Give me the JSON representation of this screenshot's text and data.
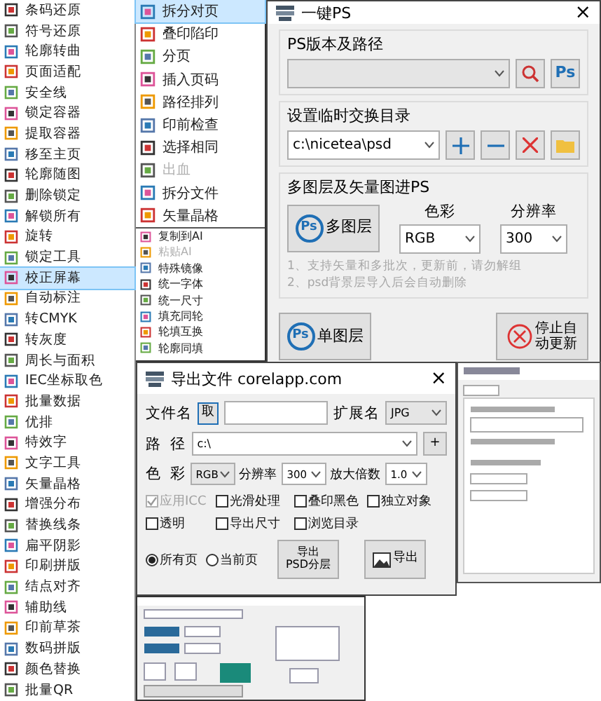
{
  "left_menu": [
    {
      "label": "条码还原",
      "selected": false
    },
    {
      "label": "符号还原",
      "selected": false
    },
    {
      "label": "轮廓转曲",
      "selected": false
    },
    {
      "label": "页面适配",
      "selected": false
    },
    {
      "label": "安全线",
      "selected": false
    },
    {
      "label": "锁定容器",
      "selected": false
    },
    {
      "label": "提取容器",
      "selected": false
    },
    {
      "label": "移至主页",
      "selected": false
    },
    {
      "label": "轮廓随图",
      "selected": false
    },
    {
      "label": "删除锁定",
      "selected": false
    },
    {
      "label": "解锁所有",
      "selected": false
    },
    {
      "label": "旋转",
      "selected": false
    },
    {
      "label": "锁定工具",
      "selected": false
    },
    {
      "label": "校正屏幕",
      "selected": true
    },
    {
      "label": "自动标注",
      "selected": false
    },
    {
      "label": "转CMYK",
      "selected": false
    },
    {
      "label": "转灰度",
      "selected": false
    },
    {
      "label": "周长与面积",
      "selected": false
    },
    {
      "label": "IEC坐标取色",
      "selected": false
    },
    {
      "label": "批量数据",
      "selected": false
    },
    {
      "label": "优排",
      "selected": false
    },
    {
      "label": "特效字",
      "selected": false
    },
    {
      "label": "文字工具",
      "selected": false
    },
    {
      "label": "矢量晶格",
      "selected": false
    },
    {
      "label": "增强分布",
      "selected": false
    },
    {
      "label": "替换线条",
      "selected": false
    },
    {
      "label": "扁平阴影",
      "selected": false
    },
    {
      "label": "印刷拼版",
      "selected": false
    },
    {
      "label": "结点对齐",
      "selected": false
    },
    {
      "label": "辅助线",
      "selected": false
    },
    {
      "label": "印前草茶",
      "selected": false
    },
    {
      "label": "数码拼版",
      "selected": false
    },
    {
      "label": "颜色替换",
      "selected": false
    },
    {
      "label": "批量QR",
      "selected": false
    }
  ],
  "sub_menu": [
    {
      "label": "拆分对页",
      "selected": true,
      "disabled": false
    },
    {
      "label": "叠印陷印",
      "selected": false,
      "disabled": false
    },
    {
      "label": "分页",
      "selected": false,
      "disabled": false
    },
    {
      "label": "插入页码",
      "selected": false,
      "disabled": false
    },
    {
      "label": "路径排列",
      "selected": false,
      "disabled": false
    },
    {
      "label": "印前检查",
      "selected": false,
      "disabled": false
    },
    {
      "label": "选择相同",
      "selected": false,
      "disabled": false
    },
    {
      "label": "出血",
      "selected": false,
      "disabled": true
    },
    {
      "label": "拆分文件",
      "selected": false,
      "disabled": false
    },
    {
      "label": "矢量晶格",
      "selected": false,
      "disabled": false
    }
  ],
  "sub_menu_small": [
    {
      "label": "复制到AI",
      "disabled": false
    },
    {
      "label": "粘贴AI",
      "disabled": true
    },
    {
      "label": "特殊镜像",
      "disabled": false
    },
    {
      "label": "统一字体",
      "disabled": false
    },
    {
      "label": "统一尺寸",
      "disabled": false
    },
    {
      "label": "填充同轮",
      "disabled": false
    },
    {
      "label": "轮填互换",
      "disabled": false
    },
    {
      "label": "轮廓同填",
      "disabled": false
    }
  ],
  "ps_dialog": {
    "title": "一键PS",
    "close": "×",
    "version_group": {
      "title": "PS版本及路径",
      "ps_button": "Ps"
    },
    "temp_group": {
      "title": "设置临时交换目录",
      "path": "c:\\nicetea\\psd"
    },
    "layers_group": {
      "title": "多图层及矢量图进PS",
      "multi_button": "多图层",
      "ps_badge": "Ps",
      "color_label": "色彩",
      "color_value": "RGB",
      "res_label": "分辨率",
      "res_value": "300",
      "notes": [
        "1、支持矢量和多批次，更新前，请勿解组",
        "2、psd背景层导入后会自动删除"
      ]
    },
    "single_button": "单图层",
    "single_badge": "Ps",
    "stop_button": "停止自动更新"
  },
  "export_dialog": {
    "title": "导出文件  corelapp.com",
    "close": "×",
    "name_label": "文件名",
    "take_button": "取",
    "ext_label": "扩展名",
    "ext_value": "JPG",
    "path_label": "路  径",
    "path_value": "c:\\",
    "add_button": "+",
    "color_label": "色  彩",
    "color_value": "RGB",
    "res_label": "分辨率",
    "res_value": "300",
    "scale_label": "放大倍数",
    "scale_value": "1.0",
    "checkboxes": [
      {
        "label": "应用ICC",
        "checked": true,
        "disabled": true
      },
      {
        "label": "光滑处理",
        "checked": false,
        "disabled": false
      },
      {
        "label": "叠印黑色",
        "checked": false,
        "disabled": false
      },
      {
        "label": "独立对象",
        "checked": false,
        "disabled": false
      },
      {
        "label": "透明",
        "checked": false,
        "disabled": false
      },
      {
        "label": "导出尺寸",
        "checked": false,
        "disabled": false
      },
      {
        "label": "浏览目录",
        "checked": false,
        "disabled": false
      }
    ],
    "radios": [
      {
        "label": "所有页",
        "selected": true
      },
      {
        "label": "当前页",
        "selected": false
      }
    ],
    "psd_button": "导出\nPSD分层",
    "export_button": "导出"
  }
}
